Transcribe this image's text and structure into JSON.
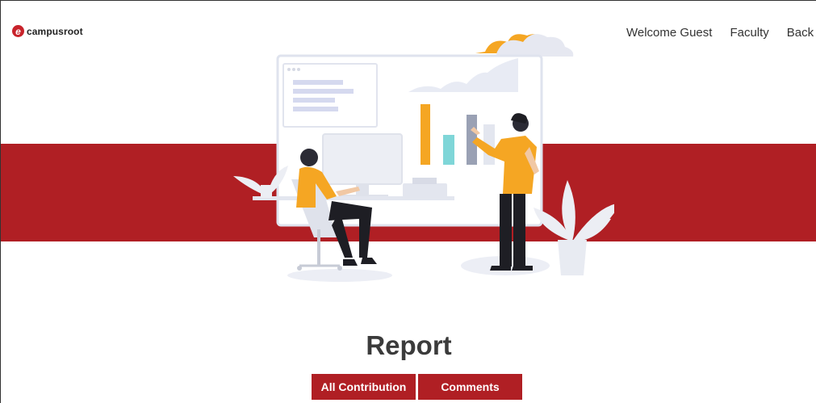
{
  "brand": {
    "logo_letter": "e",
    "name": "campusroot"
  },
  "nav": {
    "items": [
      "Welcome Guest",
      "Faculty",
      "Back"
    ]
  },
  "page": {
    "title": "Report"
  },
  "actions": {
    "all_contribution": "All Contribution",
    "comments": "Comments"
  },
  "colors": {
    "brand_red": "#b01f24",
    "accent_orange": "#f5a623",
    "accent_teal": "#7fd6d8",
    "text_dark": "#3b3b3b"
  }
}
